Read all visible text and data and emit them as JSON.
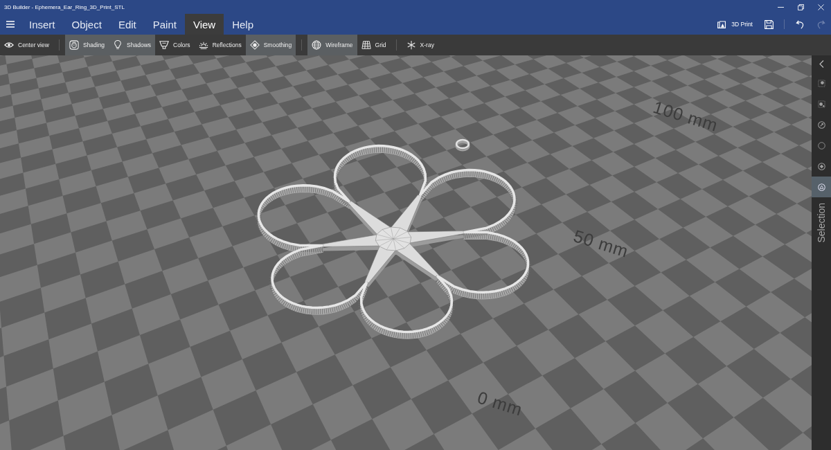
{
  "window": {
    "title": "3D Builder - Ephemera_Ear_Ring_3D_Print_STL"
  },
  "menu": [
    {
      "label": "Insert",
      "selected": false
    },
    {
      "label": "Object",
      "selected": false
    },
    {
      "label": "Edit",
      "selected": false
    },
    {
      "label": "Paint",
      "selected": false
    },
    {
      "label": "View",
      "selected": true
    },
    {
      "label": "Help",
      "selected": false
    }
  ],
  "print_button": {
    "label": "3D Print"
  },
  "undo": {
    "disabled": false
  },
  "redo": {
    "disabled": true
  },
  "toolbar": {
    "groups": [
      [
        {
          "label": "Center view",
          "on": false
        }
      ],
      [
        {
          "label": "Shading",
          "on": true
        },
        {
          "label": "Shadows",
          "on": true
        },
        {
          "label": "Colors",
          "on": false
        },
        {
          "label": "Reflections",
          "on": false
        },
        {
          "label": "Smoothing",
          "on": true
        }
      ],
      [
        {
          "label": "Wireframe",
          "on": true
        },
        {
          "label": "Grid",
          "on": false
        }
      ],
      [
        {
          "label": "X-ray",
          "on": false
        }
      ]
    ]
  },
  "viewport": {
    "floor_labels": [
      "100 mm",
      "50 mm",
      "0 mm"
    ]
  },
  "side_panel": {
    "label": "Selection",
    "items": [
      {
        "selected": false
      },
      {
        "selected": false
      },
      {
        "selected": false
      },
      {
        "selected": false
      },
      {
        "selected": false
      },
      {
        "selected": true
      }
    ]
  }
}
